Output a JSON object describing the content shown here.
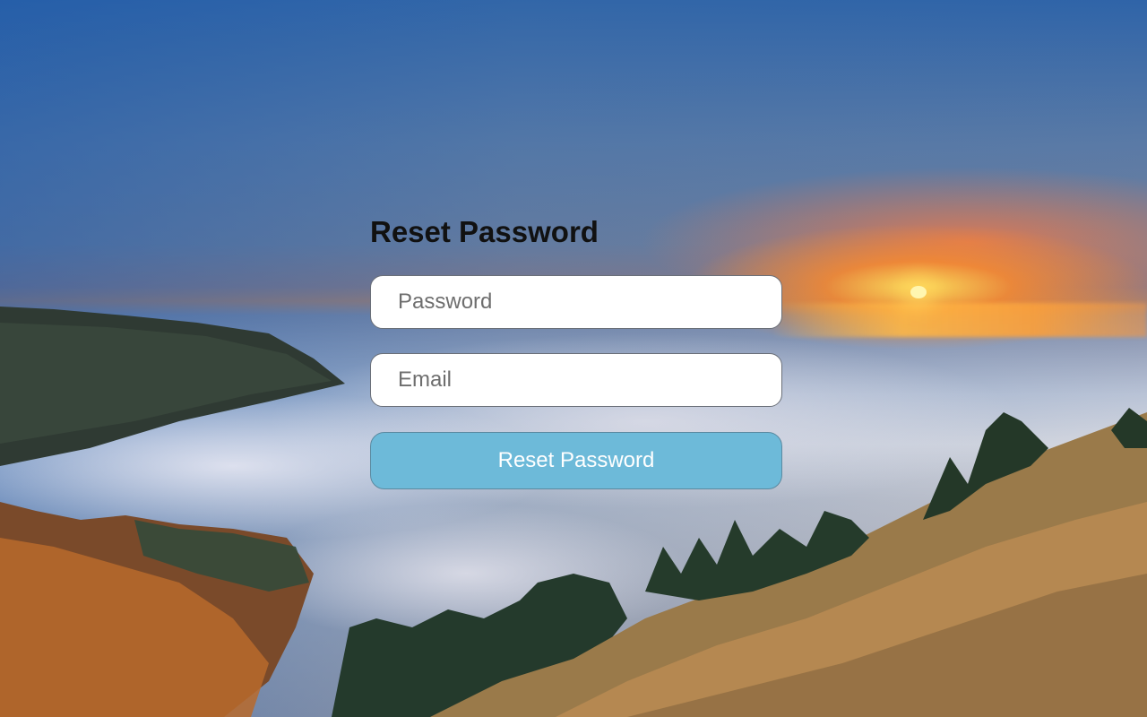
{
  "page": {
    "background": "sunset-over-fog-mountain-landscape"
  },
  "form": {
    "title": "Reset Password",
    "password_placeholder": "Password",
    "email_placeholder": "Email",
    "submit_label": "Reset Password"
  },
  "colors": {
    "button_bg": "#6dbad9",
    "button_text": "#ffffff",
    "title_text": "#111111",
    "input_bg": "#ffffff"
  }
}
